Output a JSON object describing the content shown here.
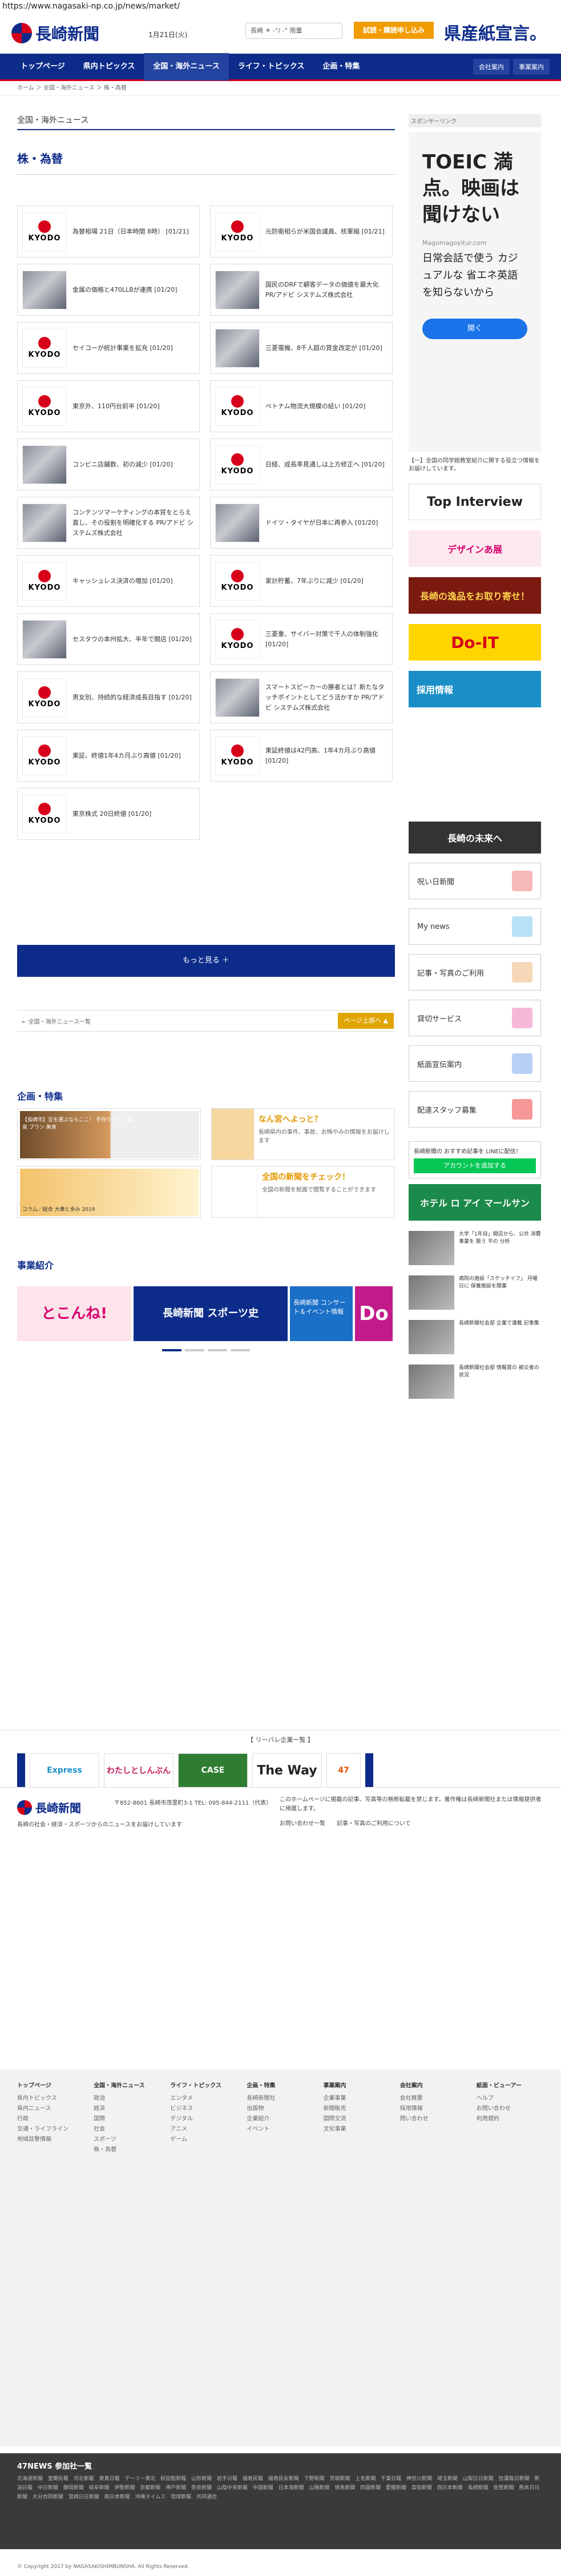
{
  "url": "https://www.nagasaki-np.co.jp/news/market/",
  "header": {
    "logo": "長崎新聞",
    "date": "1月21日(火)",
    "weather": "長崎 ☀ -°/ -° 雨量",
    "trial_button": "試読・購読申し込み",
    "ad_text": "県産紙宣言。"
  },
  "nav": {
    "items": [
      "トップページ",
      "県内トピックス",
      "全国・海外ニュース",
      "ライフ・トピックス",
      "企画・特集"
    ],
    "right": [
      "会社案内",
      "事業案内"
    ]
  },
  "breadcrumb": "ホーム ＞ 全国・海外ニュース ＞ 株・為替",
  "section_head": "全国・海外ニュース",
  "page_title": "株・為替",
  "articles": [
    {
      "text": "為替相場 21日（日本時間 8時） [01/21]",
      "thumb": "kyodo"
    },
    {
      "text": "元防衛相らが米国会議員、核軍縮 [01/21]",
      "thumb": "kyodo"
    },
    {
      "text": "金属の価格と470LLBが連携 [01/20]",
      "thumb": "photo"
    },
    {
      "text": "国民のDRFで顧客データの価値を最大化 PR/アドビ システムズ株式会社",
      "thumb": "photo"
    },
    {
      "text": "セイコーが統計事業を拡充 [01/20]",
      "thumb": "kyodo"
    },
    {
      "text": "三菱電機、8千人超の賃金改定が [01/20]",
      "thumb": "photo"
    },
    {
      "text": "東京外、110円台前半 [01/20]",
      "thumb": "kyodo"
    },
    {
      "text": "ベトナム物流大規模の結い [01/20]",
      "thumb": "kyodo"
    },
    {
      "text": "コンビニ店舗数、初の減少 [01/20]",
      "thumb": "photo"
    },
    {
      "text": "日経、成長率見通しは上方修正へ [01/20]",
      "thumb": "kyodo"
    },
    {
      "text": "コンテンツマーケティングの本質をとらえ直し、その役割を明確化する PR/アドビ システムズ株式会社",
      "thumb": "photo"
    },
    {
      "text": "ドイツ・タイヤが日本に再参入 [01/20]",
      "thumb": "photo"
    },
    {
      "text": "キャッシュレス決済の増加 [01/20]",
      "thumb": "kyodo"
    },
    {
      "text": "家計貯蓄、7年ぶりに減少 [01/20]",
      "thumb": "kyodo"
    },
    {
      "text": "セスタウの本州拡大、半年で開店 [01/20]",
      "thumb": "photo"
    },
    {
      "text": "三菱重、サイバー対策で千人の体制強化 [01/20]",
      "thumb": "kyodo"
    },
    {
      "text": "男女別、持続的な経済成長目指す [01/20]",
      "thumb": "kyodo"
    },
    {
      "text": "スマートスピーカーの勝者とは？新たなタッチポイントとしてどう活かすか PR/アドビ システムズ株式会社",
      "thumb": "photo"
    },
    {
      "text": "東証、終値1年4カ月ぶり高値 [01/20]",
      "thumb": "kyodo"
    },
    {
      "text": "東証終値は42円高、1年4カ月ぶり高値 [01/20]",
      "thumb": "kyodo"
    },
    {
      "text": "東京株式 20日終値 [01/20]",
      "thumb": "kyodo"
    }
  ],
  "more_button": "もっと見る ＋",
  "pager": {
    "prev": "← 全国・海外ニュース一覧",
    "top": "ページ上部へ ▲"
  },
  "feature": {
    "title": "企画・特集",
    "left_caption": "【長崎市】豆を選ぶならここ！ 手作りアイス 温泉 プラン 美食",
    "right_title": "なん宮へよっと？",
    "right_desc": "長崎県内の事件、事故、お悔やみの情報をお届けします",
    "second_left": "コラム／総合 大衆と歩み 2019",
    "second_right_title": "全国の新聞をチェック！",
    "second_right_desc": "全国の新聞を紙面で閲覧することができます"
  },
  "business": {
    "title": "事業紹介",
    "items": [
      "とこんね!",
      "長崎新聞 スポーツ史",
      "長崎新聞 コンサート＆イベント情報",
      "Do"
    ]
  },
  "sidebar": {
    "sponsor_label": "スポンサーリンク",
    "ad_big": "TOEIC 満点。映画は聞けない",
    "ad_url": "Magomagoyitur.com",
    "ad_small": "日常会話で使う カジュアルな 省エネ英語を知らないから",
    "ad_open": "開く",
    "note": "【一】全国の同学館教室紹介に関する役立つ情報を お届けしています。",
    "banners": [
      "Top Interview",
      "デザインあ展",
      "長崎の逸品をお取り寄せ！",
      "Do-IT",
      "採用情報",
      "長崎の未来へ"
    ],
    "links": [
      "呪い日新聞",
      "My news",
      "記事・写真のご利用",
      "貸切サービス",
      "紙面宣伝案内",
      "配達スタッフ募集"
    ],
    "line_text": "長崎新聞の おすすめ記事を LINEに配信！",
    "line_button": "アカウントを追加する",
    "hotel": "ホテル ロ アイ マールサン",
    "news": [
      "大学「1年目」開店から、公共 消費事業を 賑う 平の 分析",
      "病院の施設「スケッチイフ」 月曜日に 保養施設を開業",
      "長崎新聞社会部 企業で連載 記事集",
      "長崎新聞社会部 情報賞の 被災者の状況"
    ]
  },
  "related": {
    "head": "【 リーバレ企業一覧 】",
    "items": [
      "Express",
      "わたしとしんぶん",
      "CASE",
      "The Way",
      "47"
    ]
  },
  "footer": {
    "logo": "長崎新聞",
    "address": "〒852-8601 長崎市茂里町3-1 TEL: 095-844-2111（代表）",
    "note": "長崎の社会・経済・スポーツからのニュースをお届けしています",
    "right": "このホームページに掲載の記事、写真等の無断転載を禁じます。著作権は長崎新聞社または情報提供者に帰属します。",
    "links": [
      "お問い合わせ一覧",
      "記事・写真のご利用について"
    ]
  },
  "sitemap": [
    {
      "head": "トップページ",
      "items": [
        "県内トピックス",
        "県内ニュース",
        "行政",
        "交通・ライフライン",
        "地域目撃情報"
      ]
    },
    {
      "head": "全国・海外ニュース",
      "items": [
        "政治",
        "経済",
        "国際",
        "社会",
        "スポーツ",
        "株・為替"
      ]
    },
    {
      "head": "ライフ・トピックス",
      "items": [
        "エンタメ",
        "ビジネス",
        "デジタル",
        "アニメ",
        "ゲーム"
      ]
    },
    {
      "head": "企画・特集",
      "items": [
        "長崎新聞社",
        "出版物",
        "企業紹介",
        "イベント"
      ]
    },
    {
      "head": "事業案内",
      "items": [
        "企業事業",
        "新聞販売",
        "国際交流",
        "文化事業"
      ]
    },
    {
      "head": "会社案内",
      "items": [
        "会社概要",
        "採用情報",
        "問い合わせ"
      ]
    },
    {
      "head": "紙面・ビューアー",
      "items": [
        "ヘルプ",
        "お問い合わせ",
        "利用規約"
      ]
    }
  ],
  "f47": {
    "title": "47NEWS 参加社一覧",
    "links": "北海道新聞 室蘭民報 河北新報 東奥日報 デーリー東北 秋田魁新報 山形新聞 岩手日報 福島民報 福島民友新聞 下野新聞 茨城新聞 上毛新聞 千葉日報 神奈川新聞 埼玉新聞 山梨日日新聞 信濃毎日新聞 新潟日報 中日新聞 静岡新聞 岐阜新聞 伊勢新聞 京都新聞 神戸新聞 奈良新聞 山陰中央新報 中国新聞 日本海新聞 山陽新聞 徳島新聞 四国新聞 愛媛新聞 高知新聞 西日本新聞 長崎新聞 佐賀新聞 熊本日日新聞 大分合同新聞 宮崎日日新聞 南日本新聞 沖縄タイムス 琉球新報 共同通信"
  },
  "copyright": "© Copyright 2017 by NAGASAKISHIMBUNSHA. All Rights Reserved."
}
